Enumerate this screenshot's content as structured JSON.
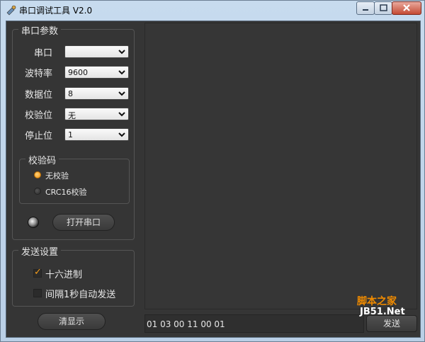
{
  "window": {
    "title": "串口调试工具 V2.0"
  },
  "serial_params": {
    "title": "串口参数",
    "port": {
      "label": "串口",
      "value": ""
    },
    "baud": {
      "label": "波特率",
      "value": "9600"
    },
    "data_bits": {
      "label": "数据位",
      "value": "8"
    },
    "parity": {
      "label": "校验位",
      "value": "无"
    },
    "stop_bits": {
      "label": "停止位",
      "value": "1"
    },
    "checksum": {
      "title": "校验码",
      "options": [
        {
          "label": "无校验",
          "selected": true
        },
        {
          "label": "CRC16校验",
          "selected": false
        }
      ]
    },
    "open_button": "打开串口"
  },
  "send_settings": {
    "title": "发送设置",
    "hex": {
      "label": "十六进制",
      "checked": true
    },
    "auto_send": {
      "label": "间隔1秒自动发送",
      "checked": false
    }
  },
  "clear_button": "清显示",
  "send_input": {
    "value": "01 03 00 11 00 01"
  },
  "send_button": "发送",
  "watermark": {
    "line1": "脚本之家",
    "line2": "JB51.Net"
  },
  "colors": {
    "accent": "#f08f0e",
    "panel": "#353535"
  }
}
